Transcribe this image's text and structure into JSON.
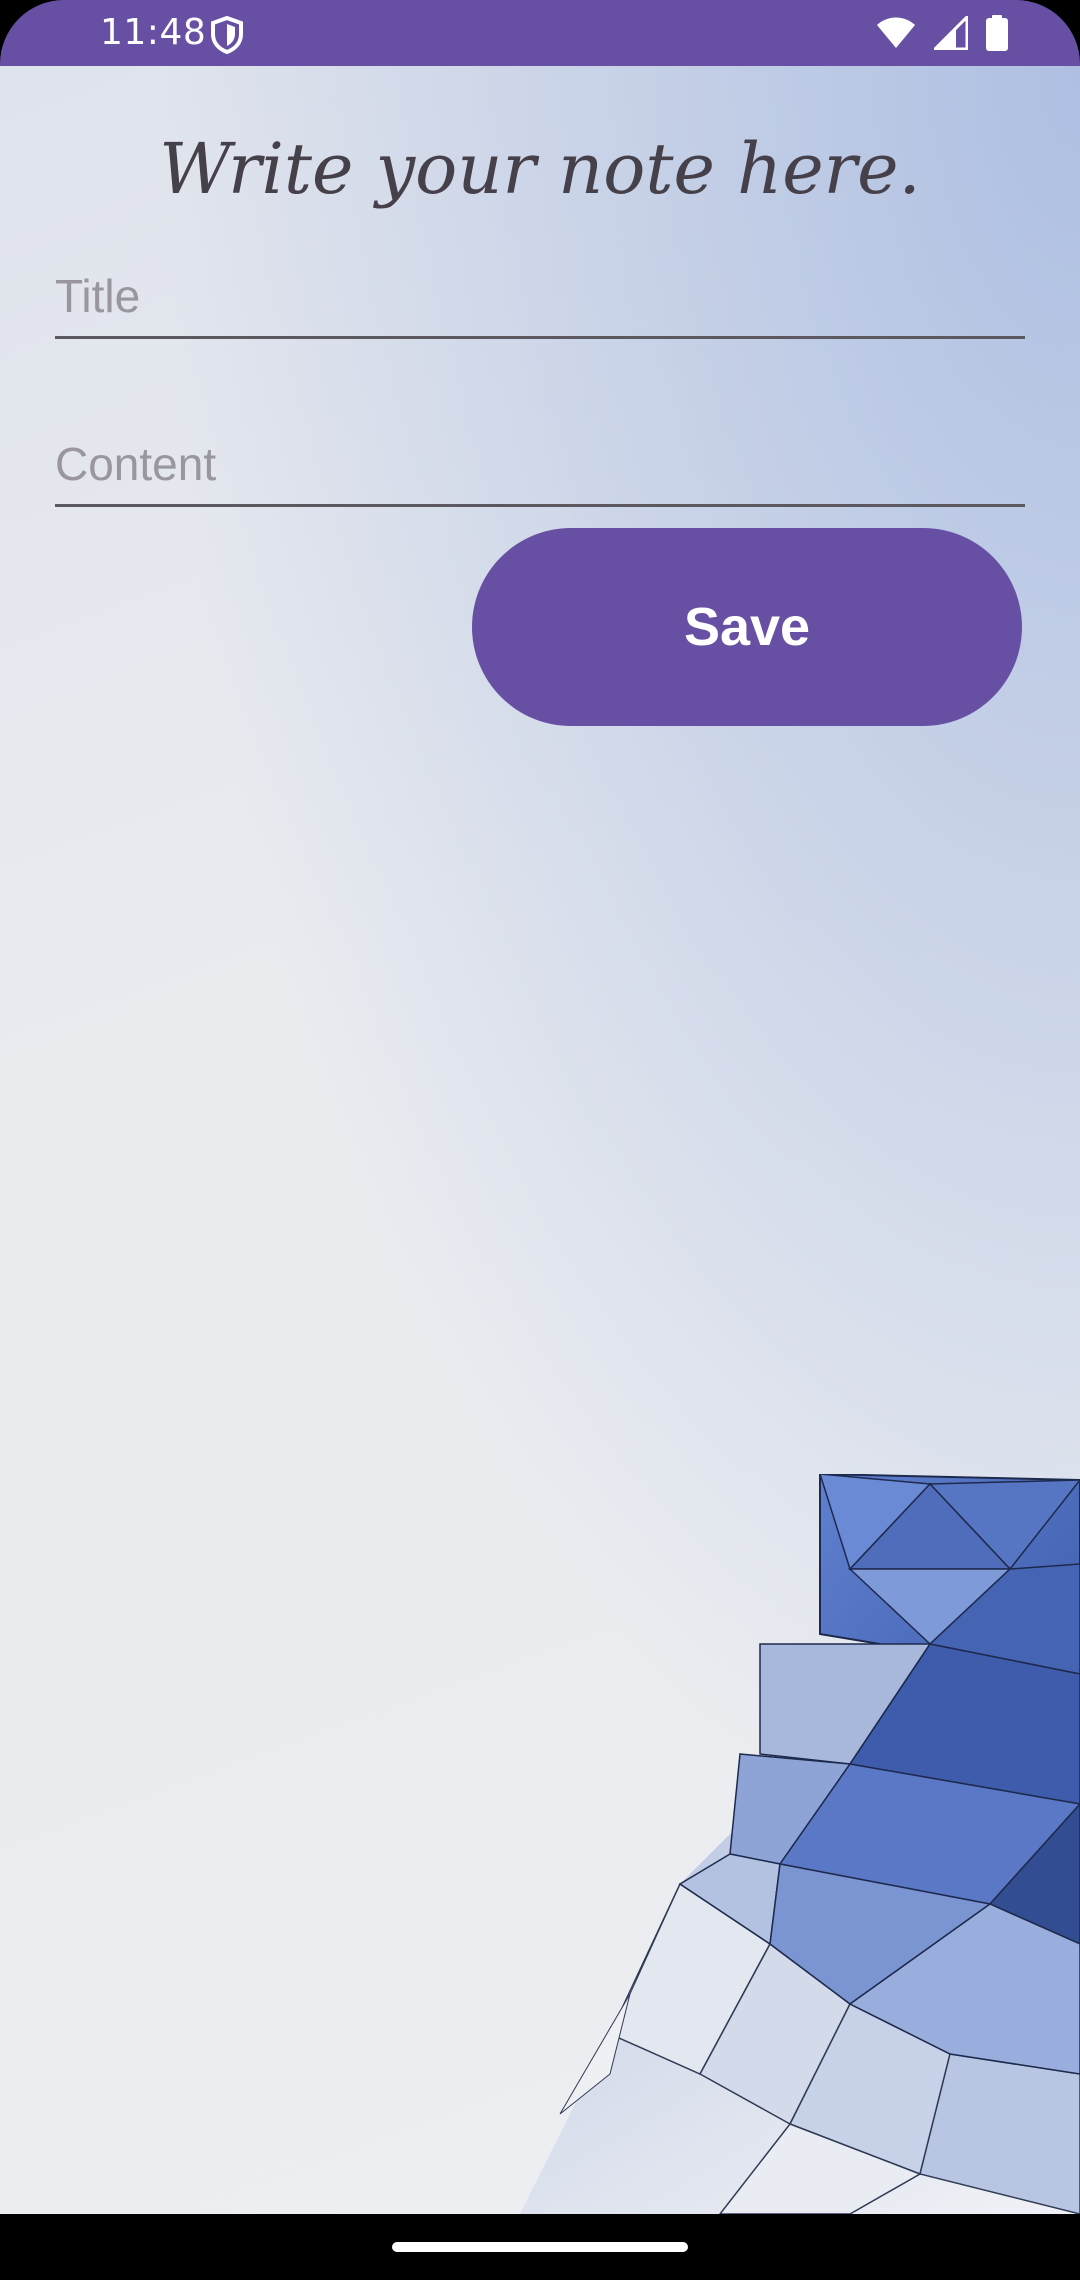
{
  "status_bar": {
    "time": "11:48",
    "icons": [
      "shield-icon",
      "wifi-icon",
      "signal-icon",
      "battery-icon"
    ],
    "color": "#6750a4"
  },
  "note_editor": {
    "heading": "Write your note here.",
    "title_field": {
      "placeholder": "Title",
      "value": ""
    },
    "content_field": {
      "placeholder": "Content",
      "value": ""
    },
    "save_label": "Save"
  },
  "colors": {
    "accent": "#6750a4",
    "heading_text": "#454049",
    "placeholder": "#99969e"
  }
}
